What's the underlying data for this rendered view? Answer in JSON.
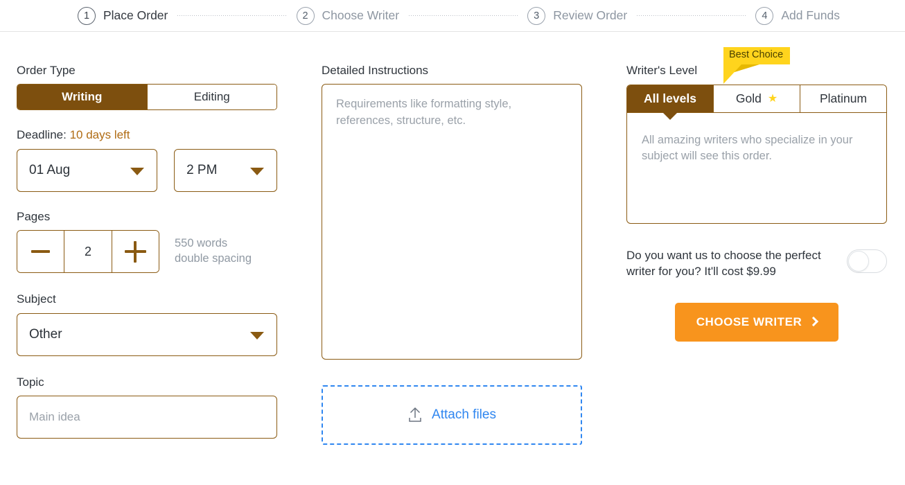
{
  "stepper": {
    "steps": [
      {
        "num": "1",
        "label": "Place Order",
        "active": true
      },
      {
        "num": "2",
        "label": "Choose Writer",
        "active": false
      },
      {
        "num": "3",
        "label": "Review Order",
        "active": false
      },
      {
        "num": "4",
        "label": "Add Funds",
        "active": false
      }
    ]
  },
  "order_type": {
    "label": "Order Type",
    "options": [
      "Writing",
      "Editing"
    ],
    "selected": "Writing"
  },
  "deadline": {
    "label_prefix": "Deadline",
    "label_separator": ": ",
    "days_left": "10 days left",
    "date_value": "01 Aug",
    "time_value": "2 PM"
  },
  "pages": {
    "label": "Pages",
    "decrement_label": "—",
    "value": "2",
    "increment_label": "+",
    "note_line1": "550 words",
    "note_line2": "double spacing"
  },
  "subject": {
    "label": "Subject",
    "value": "Other"
  },
  "topic": {
    "label": "Topic",
    "value": "",
    "placeholder": "Main idea"
  },
  "instructions": {
    "label": "Detailed Instructions",
    "value": "",
    "placeholder": "Requirements like formatting style, references, structure, etc."
  },
  "attach": {
    "label": "Attach files",
    "icon": "upload-icon"
  },
  "writer_level": {
    "label": "Writer's Level",
    "badge": "Best Choice",
    "tabs": [
      {
        "label": "All levels",
        "selected": true,
        "star": false
      },
      {
        "label": "Gold",
        "selected": false,
        "star": true
      },
      {
        "label": "Platinum",
        "selected": false,
        "star": false
      }
    ],
    "description": "All amazing writers who specialize in your subject will see this order."
  },
  "perfect_writer": {
    "text": "Do you want us to choose the perfect writer for you? It'll cost $9.99",
    "toggle_state": "off"
  },
  "cta": {
    "label": "CHOOSE WRITER",
    "icon": "chevron-right-icon"
  },
  "colors": {
    "brown": "#7d4f0e",
    "brown_border": "#8a5a12",
    "accent_orange": "#f8941d",
    "link_blue": "#2f86f0",
    "badge_yellow": "#ffd41d",
    "muted_gray": "#9aa1a9"
  }
}
